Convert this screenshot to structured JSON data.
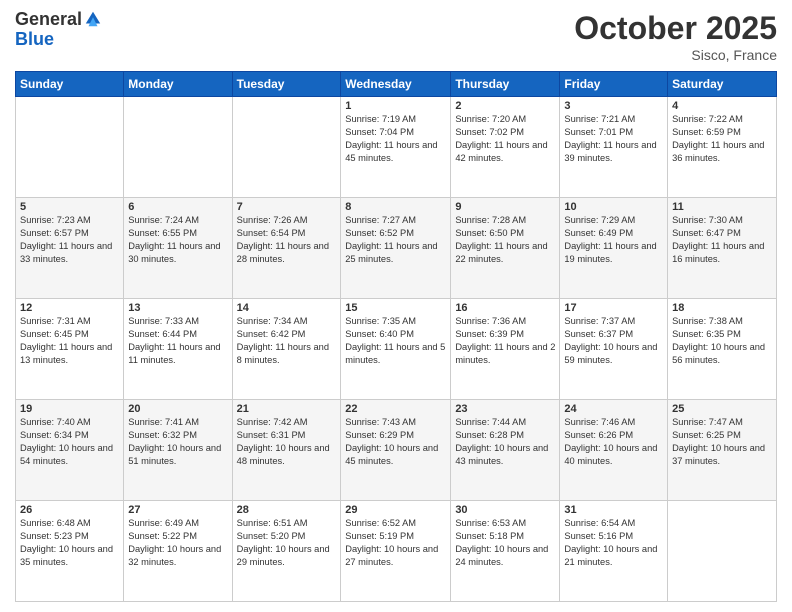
{
  "logo": {
    "general": "General",
    "blue": "Blue"
  },
  "header": {
    "month": "October 2025",
    "location": "Sisco, France"
  },
  "weekdays": [
    "Sunday",
    "Monday",
    "Tuesday",
    "Wednesday",
    "Thursday",
    "Friday",
    "Saturday"
  ],
  "weeks": [
    [
      {
        "day": "",
        "info": ""
      },
      {
        "day": "",
        "info": ""
      },
      {
        "day": "",
        "info": ""
      },
      {
        "day": "1",
        "info": "Sunrise: 7:19 AM\nSunset: 7:04 PM\nDaylight: 11 hours and 45 minutes."
      },
      {
        "day": "2",
        "info": "Sunrise: 7:20 AM\nSunset: 7:02 PM\nDaylight: 11 hours and 42 minutes."
      },
      {
        "day": "3",
        "info": "Sunrise: 7:21 AM\nSunset: 7:01 PM\nDaylight: 11 hours and 39 minutes."
      },
      {
        "day": "4",
        "info": "Sunrise: 7:22 AM\nSunset: 6:59 PM\nDaylight: 11 hours and 36 minutes."
      }
    ],
    [
      {
        "day": "5",
        "info": "Sunrise: 7:23 AM\nSunset: 6:57 PM\nDaylight: 11 hours and 33 minutes."
      },
      {
        "day": "6",
        "info": "Sunrise: 7:24 AM\nSunset: 6:55 PM\nDaylight: 11 hours and 30 minutes."
      },
      {
        "day": "7",
        "info": "Sunrise: 7:26 AM\nSunset: 6:54 PM\nDaylight: 11 hours and 28 minutes."
      },
      {
        "day": "8",
        "info": "Sunrise: 7:27 AM\nSunset: 6:52 PM\nDaylight: 11 hours and 25 minutes."
      },
      {
        "day": "9",
        "info": "Sunrise: 7:28 AM\nSunset: 6:50 PM\nDaylight: 11 hours and 22 minutes."
      },
      {
        "day": "10",
        "info": "Sunrise: 7:29 AM\nSunset: 6:49 PM\nDaylight: 11 hours and 19 minutes."
      },
      {
        "day": "11",
        "info": "Sunrise: 7:30 AM\nSunset: 6:47 PM\nDaylight: 11 hours and 16 minutes."
      }
    ],
    [
      {
        "day": "12",
        "info": "Sunrise: 7:31 AM\nSunset: 6:45 PM\nDaylight: 11 hours and 13 minutes."
      },
      {
        "day": "13",
        "info": "Sunrise: 7:33 AM\nSunset: 6:44 PM\nDaylight: 11 hours and 11 minutes."
      },
      {
        "day": "14",
        "info": "Sunrise: 7:34 AM\nSunset: 6:42 PM\nDaylight: 11 hours and 8 minutes."
      },
      {
        "day": "15",
        "info": "Sunrise: 7:35 AM\nSunset: 6:40 PM\nDaylight: 11 hours and 5 minutes."
      },
      {
        "day": "16",
        "info": "Sunrise: 7:36 AM\nSunset: 6:39 PM\nDaylight: 11 hours and 2 minutes."
      },
      {
        "day": "17",
        "info": "Sunrise: 7:37 AM\nSunset: 6:37 PM\nDaylight: 10 hours and 59 minutes."
      },
      {
        "day": "18",
        "info": "Sunrise: 7:38 AM\nSunset: 6:35 PM\nDaylight: 10 hours and 56 minutes."
      }
    ],
    [
      {
        "day": "19",
        "info": "Sunrise: 7:40 AM\nSunset: 6:34 PM\nDaylight: 10 hours and 54 minutes."
      },
      {
        "day": "20",
        "info": "Sunrise: 7:41 AM\nSunset: 6:32 PM\nDaylight: 10 hours and 51 minutes."
      },
      {
        "day": "21",
        "info": "Sunrise: 7:42 AM\nSunset: 6:31 PM\nDaylight: 10 hours and 48 minutes."
      },
      {
        "day": "22",
        "info": "Sunrise: 7:43 AM\nSunset: 6:29 PM\nDaylight: 10 hours and 45 minutes."
      },
      {
        "day": "23",
        "info": "Sunrise: 7:44 AM\nSunset: 6:28 PM\nDaylight: 10 hours and 43 minutes."
      },
      {
        "day": "24",
        "info": "Sunrise: 7:46 AM\nSunset: 6:26 PM\nDaylight: 10 hours and 40 minutes."
      },
      {
        "day": "25",
        "info": "Sunrise: 7:47 AM\nSunset: 6:25 PM\nDaylight: 10 hours and 37 minutes."
      }
    ],
    [
      {
        "day": "26",
        "info": "Sunrise: 6:48 AM\nSunset: 5:23 PM\nDaylight: 10 hours and 35 minutes."
      },
      {
        "day": "27",
        "info": "Sunrise: 6:49 AM\nSunset: 5:22 PM\nDaylight: 10 hours and 32 minutes."
      },
      {
        "day": "28",
        "info": "Sunrise: 6:51 AM\nSunset: 5:20 PM\nDaylight: 10 hours and 29 minutes."
      },
      {
        "day": "29",
        "info": "Sunrise: 6:52 AM\nSunset: 5:19 PM\nDaylight: 10 hours and 27 minutes."
      },
      {
        "day": "30",
        "info": "Sunrise: 6:53 AM\nSunset: 5:18 PM\nDaylight: 10 hours and 24 minutes."
      },
      {
        "day": "31",
        "info": "Sunrise: 6:54 AM\nSunset: 5:16 PM\nDaylight: 10 hours and 21 minutes."
      },
      {
        "day": "",
        "info": ""
      }
    ]
  ]
}
